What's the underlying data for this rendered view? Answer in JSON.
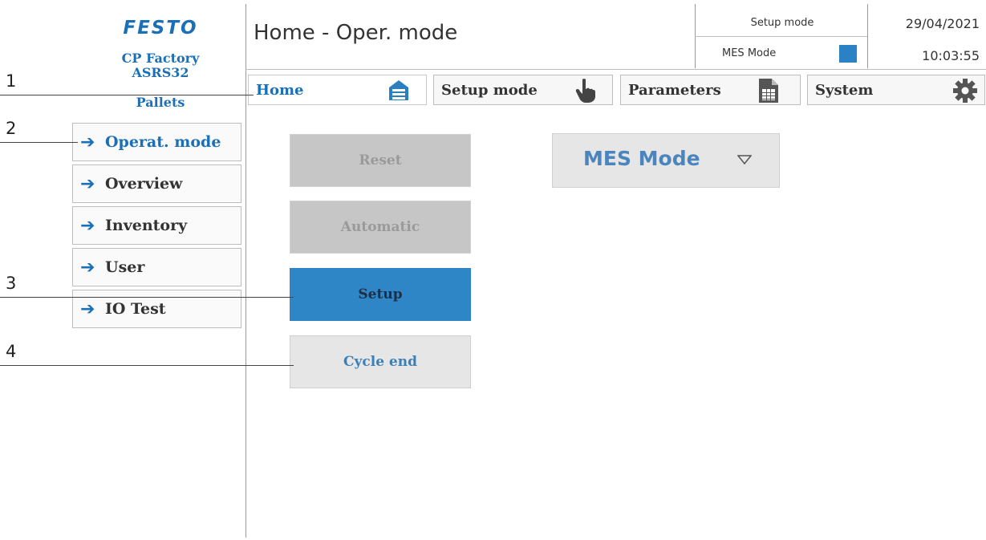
{
  "logo": {
    "brand": "FESTO"
  },
  "station": {
    "line1": "CP Factory",
    "line2": "ASRS32",
    "line3": "Pallets"
  },
  "header": {
    "title": "Home - Oper. mode",
    "setup_mode_label": "Setup mode",
    "mes_mode_label": "MES Mode",
    "mes_indicator_color": "#2a82c4",
    "date": "29/04/2021",
    "time": "10:03:55"
  },
  "nav": {
    "items": [
      {
        "label": "Home",
        "icon": "home-warehouse-icon",
        "active": true
      },
      {
        "label": "Setup mode",
        "icon": "hand-pointer-icon",
        "active": false
      },
      {
        "label": "Parameters",
        "icon": "document-table-icon",
        "active": false
      },
      {
        "label": "System",
        "icon": "gear-icon",
        "active": false
      }
    ]
  },
  "sidebar": {
    "items": [
      {
        "label": "Operat. mode",
        "icon": "arrow-right-icon",
        "active": true
      },
      {
        "label": "Overview",
        "icon": "arrow-right-icon",
        "active": false
      },
      {
        "label": "Inventory",
        "icon": "arrow-right-icon",
        "active": false
      },
      {
        "label": "User",
        "icon": "arrow-right-icon",
        "active": false
      },
      {
        "label": "IO Test",
        "icon": "arrow-right-icon",
        "active": false
      }
    ]
  },
  "main": {
    "buttons": [
      {
        "label": "Reset",
        "state": "disabled"
      },
      {
        "label": "Automatic",
        "state": "disabled"
      },
      {
        "label": "Setup",
        "state": "active"
      },
      {
        "label": "Cycle end",
        "state": "normal"
      }
    ],
    "mode_select": {
      "value": "MES Mode"
    }
  },
  "callouts": [
    "1",
    "2",
    "3",
    "4"
  ],
  "colors": {
    "accent": "#1b6fb7",
    "active_button": "#2f86c6",
    "disabled_button": "#c6c6c6",
    "normal_button": "#e6e6e6"
  }
}
